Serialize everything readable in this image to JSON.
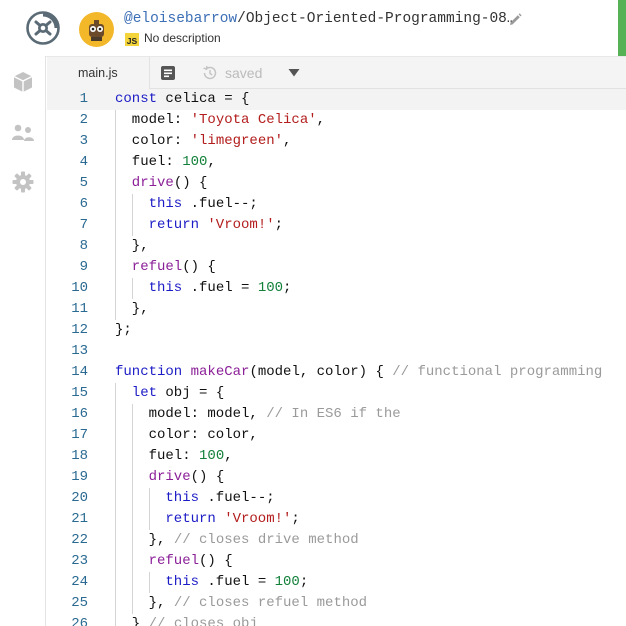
{
  "header": {
    "username": "@eloisebarrow",
    "repl_name": "/Object-Oriented-Programming-08…",
    "language_badge": "JS",
    "description": "No description",
    "accent_color": "#56b254"
  },
  "sidebar": {
    "items": [
      {
        "name": "files",
        "icon": "cube-icon"
      },
      {
        "name": "multiplayer",
        "icon": "users-icon"
      },
      {
        "name": "settings",
        "icon": "gear-icon"
      }
    ]
  },
  "tabbar": {
    "file_tab": "main.js",
    "format_icon": "format-icon",
    "status": "saved"
  },
  "editor": {
    "active_line": 1,
    "lines": [
      {
        "n": "1",
        "indent": 0,
        "tokens": [
          [
            "kw",
            "const"
          ],
          [
            "",
            "celica = {"
          ]
        ]
      },
      {
        "n": "2",
        "indent": 1,
        "tokens": [
          [
            "",
            "model: "
          ],
          [
            "str",
            "'Toyota Celica'"
          ],
          [
            "",
            ","
          ]
        ]
      },
      {
        "n": "3",
        "indent": 1,
        "tokens": [
          [
            "",
            "color: "
          ],
          [
            "str",
            "'limegreen'"
          ],
          [
            "",
            ","
          ]
        ]
      },
      {
        "n": "4",
        "indent": 1,
        "tokens": [
          [
            "",
            "fuel: "
          ],
          [
            "num",
            "100"
          ],
          [
            "",
            ","
          ]
        ]
      },
      {
        "n": "5",
        "indent": 1,
        "tokens": [
          [
            "fn",
            "drive"
          ],
          [
            "",
            "() {"
          ]
        ]
      },
      {
        "n": "6",
        "indent": 2,
        "tokens": [
          [
            "kw",
            "this"
          ],
          [
            "",
            ".fuel--;"
          ]
        ]
      },
      {
        "n": "7",
        "indent": 2,
        "tokens": [
          [
            "kw",
            "return"
          ],
          [
            "",
            ""
          ],
          [
            "str",
            "'Vroom!'"
          ],
          [
            "",
            ";"
          ]
        ]
      },
      {
        "n": "8",
        "indent": 1,
        "tokens": [
          [
            "",
            "},"
          ]
        ]
      },
      {
        "n": "9",
        "indent": 1,
        "tokens": [
          [
            "fn",
            "refuel"
          ],
          [
            "",
            "() {"
          ]
        ]
      },
      {
        "n": "10",
        "indent": 2,
        "tokens": [
          [
            "kw",
            "this"
          ],
          [
            "",
            ".fuel = "
          ],
          [
            "num",
            "100"
          ],
          [
            "",
            ";"
          ]
        ]
      },
      {
        "n": "11",
        "indent": 1,
        "tokens": [
          [
            "",
            "},"
          ]
        ]
      },
      {
        "n": "12",
        "indent": 0,
        "tokens": [
          [
            "",
            "};"
          ]
        ]
      },
      {
        "n": "13",
        "indent": 0,
        "tokens": []
      },
      {
        "n": "14",
        "indent": 0,
        "tokens": [
          [
            "kw",
            "function"
          ],
          [
            "",
            ""
          ],
          [
            "fn",
            "makeCar"
          ],
          [
            "",
            "(model, color) { "
          ],
          [
            "cm",
            "// functional programming"
          ]
        ]
      },
      {
        "n": "15",
        "indent": 1,
        "tokens": [
          [
            "kw",
            "let"
          ],
          [
            "",
            "obj = {"
          ]
        ]
      },
      {
        "n": "16",
        "indent": 2,
        "tokens": [
          [
            "",
            "model: model, "
          ],
          [
            "cm",
            "// In ES6 if the"
          ]
        ]
      },
      {
        "n": "17",
        "indent": 2,
        "tokens": [
          [
            "",
            "color: color,"
          ]
        ]
      },
      {
        "n": "18",
        "indent": 2,
        "tokens": [
          [
            "",
            "fuel: "
          ],
          [
            "num",
            "100"
          ],
          [
            "",
            ","
          ]
        ]
      },
      {
        "n": "19",
        "indent": 2,
        "tokens": [
          [
            "fn",
            "drive"
          ],
          [
            "",
            "() {"
          ]
        ]
      },
      {
        "n": "20",
        "indent": 3,
        "tokens": [
          [
            "kw",
            "this"
          ],
          [
            "",
            ".fuel--;"
          ]
        ]
      },
      {
        "n": "21",
        "indent": 3,
        "tokens": [
          [
            "kw",
            "return"
          ],
          [
            "",
            ""
          ],
          [
            "str",
            "'Vroom!'"
          ],
          [
            "",
            ";"
          ]
        ]
      },
      {
        "n": "22",
        "indent": 2,
        "tokens": [
          [
            "",
            "}, "
          ],
          [
            "cm",
            "// closes drive method"
          ]
        ]
      },
      {
        "n": "23",
        "indent": 2,
        "tokens": [
          [
            "fn",
            "refuel"
          ],
          [
            "",
            "() {"
          ]
        ]
      },
      {
        "n": "24",
        "indent": 3,
        "tokens": [
          [
            "kw",
            "this"
          ],
          [
            "",
            ".fuel = "
          ],
          [
            "num",
            "100"
          ],
          [
            "",
            ";"
          ]
        ]
      },
      {
        "n": "25",
        "indent": 2,
        "tokens": [
          [
            "",
            "}, "
          ],
          [
            "cm",
            "// closes refuel method"
          ]
        ]
      },
      {
        "n": "26",
        "indent": 1,
        "tokens": [
          [
            "",
            "} "
          ],
          [
            "cm",
            "// closes obj"
          ]
        ]
      }
    ]
  }
}
